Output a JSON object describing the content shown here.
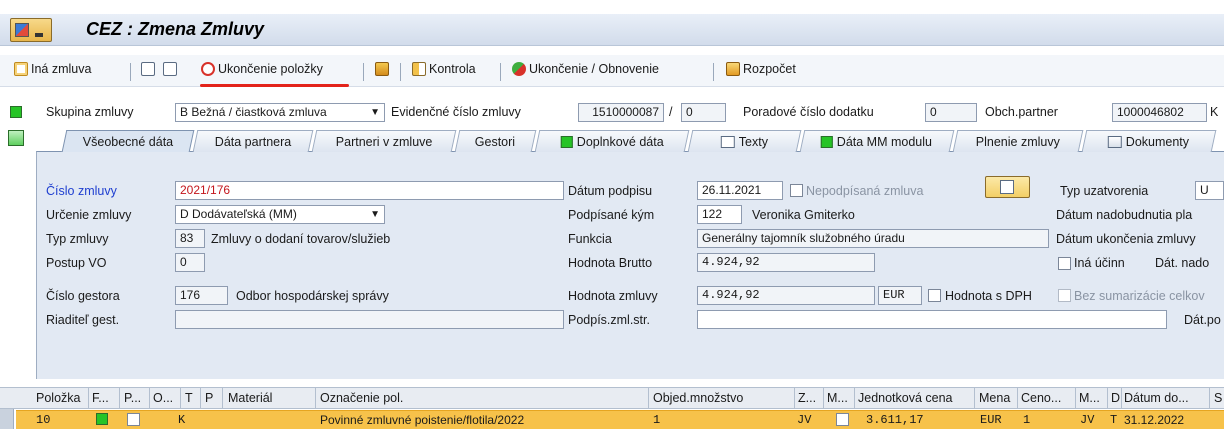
{
  "window": {
    "title": "CEZ : Zmena Zmluvy"
  },
  "colors": {
    "accent_red": "#e3231b",
    "selected_row": "#f7c24a",
    "required_label": "#1f3fd0",
    "value_red": "#c4161c"
  },
  "toolbar": {
    "other_contract": "Iná zmluva",
    "end_item": "Ukončenie položky",
    "check": "Kontrola",
    "end_renewal": "Ukončenie / Obnovenie",
    "budget": "Rozpočet"
  },
  "header": {
    "group_label": "Skupina zmluvy",
    "group_value": "B Bežná / čiastková zmluva",
    "evid_label": "Evidenčné číslo zmluvy",
    "evid_value": "1510000087",
    "evid_sep": "/",
    "evid_sub": "0",
    "addendum_label": "Poradové číslo dodatku",
    "addendum_value": "0",
    "partner_label": "Obch.partner",
    "partner_value": "1000046802",
    "partner_tail": "K"
  },
  "tabs": [
    {
      "label": "Všeobecné dáta",
      "active": true
    },
    {
      "label": "Dáta partnera"
    },
    {
      "label": "Partneri v zmluve"
    },
    {
      "label": "Gestori"
    },
    {
      "label": "Doplnkové dáta",
      "icon": "green-square-icon"
    },
    {
      "label": "Texty",
      "icon": "text-icon"
    },
    {
      "label": "Dáta MM modulu",
      "icon": "green-square-icon"
    },
    {
      "label": "Plnenie zmluvy"
    },
    {
      "label": "Dokumenty",
      "icon": "documents-icon"
    }
  ],
  "form": {
    "cislo_label": "Číslo zmluvy",
    "cislo_value": "2021/176",
    "urcenie_label": "Určenie zmluvy",
    "urcenie_value": "D Dodávateľská (MM)",
    "typ_label": "Typ zmluvy",
    "typ_code": "83",
    "typ_text": "Zmluvy o dodaní tovarov/služieb",
    "postup_label": "Postup VO",
    "postup_value": "0",
    "gestor_label": "Číslo gestora",
    "gestor_code": "176",
    "gestor_text": "Odbor hospodárskej správy",
    "riaditel_label": "Riaditeľ gest.",
    "datum_podpisu_label": "Dátum podpisu",
    "datum_podpisu_value": "26.11.2021",
    "nepodpisana_label": "Nepodpísaná zmluva",
    "podpisane_label": "Podpísané kým",
    "podpisane_code": "122",
    "podpisane_name": "Veronika Gmiterko",
    "funkcia_label": "Funkcia",
    "funkcia_value": "Generálny tajomník služobného úradu",
    "brutto_label": "Hodnota Brutto",
    "brutto_value": "4.924,92",
    "hodnota_label": "Hodnota zmluvy",
    "hodnota_value": "4.924,92",
    "mena_value": "EUR",
    "dph_label": "Hodnota s DPH",
    "podpis_str_label": "Podpís.zml.str.",
    "typ_uzav_label": "Typ uzatvorenia",
    "typ_uzav_value": "U",
    "nadobudnutia_label": "Dátum nadobudnutia pla",
    "ukoncenia_label": "Dátum ukončenia zmluvy",
    "ina_ucinn_label": "Iná účinn",
    "dat_nado_label": "Dát. nado",
    "bez_sum_label": "Bez sumarizácie celkov",
    "dat_po_label": "Dát.po"
  },
  "table": {
    "columns": [
      "Položka",
      "F...",
      "P...",
      "O...",
      "T",
      "P",
      "Materiál",
      "Označenie pol.",
      "Objed.množstvo",
      "Z...",
      "M...",
      "Jednotková cena",
      "Mena",
      "Ceno...",
      "M...",
      "D",
      "Dátum do...",
      "S"
    ],
    "row": {
      "polozka": "10",
      "o": "K",
      "oznacenie": "Povinné zmluvné poistenie/flotila/2022",
      "mnozstvo": "1",
      "z": "JV",
      "cena": "3.611,17",
      "mena": "EUR",
      "ceno": "1",
      "m": "JV",
      "d": "T",
      "datum": "31.12.2022"
    }
  }
}
